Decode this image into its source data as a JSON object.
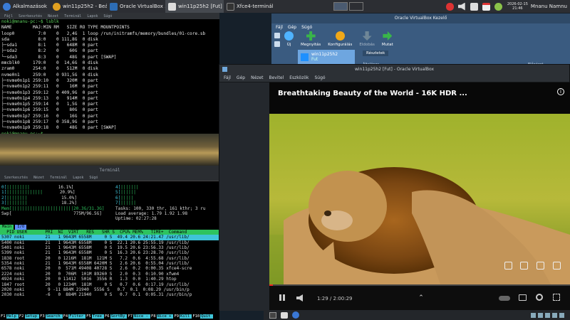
{
  "panel": {
    "apps_label": "Alkalmazások",
    "tasks": [
      "win11p25h2 - Beál...",
      "Oracle VirtualBox ...",
      "win11p25h2 [Fut] ...",
      "Xfce4-terminál"
    ],
    "date": "2026-02-15",
    "time": "21:46",
    "user": "Mnanu Namnu"
  },
  "term1": {
    "menu": [
      "Fájl",
      "Szerkesztés",
      "Nézet",
      "Terminál",
      "Lapok",
      "Súgó"
    ],
    "lines": [
      "noki@mnanu-pc:~$ lsblk",
      "NAME        MAJ:MIN RM   SIZE RO TYPE MOUNTPOINTS",
      "loop0         7:0    0   2,4G  1 loop /run/initramfs/memory/bundles/01-core.sb",
      "sda           8:0    0 111,8G  0 disk",
      "├─sda1        8:1    0   648M  0 part",
      "├─sda2        8:2    0    60G  0 part",
      "└─sda3        8:3    0    48G  0 part [SWAP]",
      "mmcblk0     179:0    0  14,6G  0 disk",
      "zram0       254:0    0   512M  0 disk",
      "nvme0n1     259:0    0 931,5G  0 disk",
      "├─nvme0n1p1 259:10   0   320M  0 part",
      "├─nvme0n1p2 259:11   0    16M  0 part",
      "├─nvme0n1p3 259:12   0 409,9G  0 part",
      "├─nvme0n1p4 259:13   0   914M  0 part",
      "├─nvme0n1p5 259:14   0   1,5G  0 part",
      "├─nvme0n1p6 259:15   0    80G  0 part",
      "├─nvme0n1p7 259:16   0    16G  0 part",
      "├─nvme0n1p8 259:17   0 358,9G  0 part",
      "└─nvme0n1p9 259:18   0    48G  0 part [SWAP]",
      "noki@mnanu-pc:~$ "
    ]
  },
  "term2": {
    "title": "Terminál",
    "menu": [
      "Szerkesztés",
      "Nézet",
      "Terminál",
      "Lapok",
      "Súgó"
    ],
    "cpu_left": [
      {
        "label": "0[",
        "bars": "|||||||||",
        "pct": "16.1%]"
      },
      {
        "label": "1[",
        "bars": "||||||||||||||",
        "pct": "20.9%]"
      },
      {
        "label": "2[",
        "bars": "||||||||",
        "pct": "15.0%]"
      },
      {
        "label": "3[",
        "bars": "||||||||",
        "pct": "18.2%]"
      }
    ],
    "cpu_right": [
      "4[",
      "5[",
      "6[",
      "7["
    ],
    "mem_line": "Mem[||||||||||||||||||||||||20.3G/31.3G]",
    "swp_line": "Swp[                        775M/96.5G]",
    "tasks": "Tasks: 100, 330 thr, 161 kthr; 3 ru",
    "load": "Load average: 1.79 1.92 1.98",
    "uptime": "Uptime: 02:27:28",
    "tabs": [
      "Main",
      "I/O"
    ],
    "header": "  PID USER       PRI  NI  VIRT   RES   SHR S  CPU% MEM%   TIME+  Command",
    "rows": [
      "5307 noki        21   1 9643M 6558M     0 S  49.4 20.6 24:21.47 /usr/lib/",
      "5400 noki        21   1 9643M 6558M     0 S  22.1 20.6 25:55.19 /usr/lib/",
      "5401 noki        21   1 9643M 6558M     0 S  19.5 20.6 23:56.33 /usr/lib/",
      "5399 noki        21   1 9643M 6558M     0 S  16.3 20.6 23:28.70 /usr/lib/",
      "1838 root        20   0 1216M  181M  121M S   7.2  0.6  4:55.68 /usr/lib/",
      "5354 noki        21   1 9643M 6558M 6420M S   2.6 20.6  0:55.04 /usr/lib/",
      "6578 noki        20   0  571M 49408 40728 S   2.6  0.2  0:00.35 xfce4-scre",
      "2224 noki        20   0  706M  101M 89260 S   2.0  0.3  0:10.90 xfwm4",
      "4924 noki        20   0 11412  5016  3556 R   1.3  0.0  1:40.29 htop",
      "1847 root        20   0 1234M  181M     0 S   0.7  0.6  0:17.19 /usr/lib/",
      "2020 noki         9 -11 884M 21940  5556 S   0.7  0.1  0:08.29 /usr/bin/p",
      "2030 noki        -6   0  884M 21940     0 S   0.7  0.1  0:05.31 /usr/bin/p"
    ],
    "fkeys": [
      {
        "k": "F1",
        "l": "Help"
      },
      {
        "k": "F2",
        "l": "Setup"
      },
      {
        "k": "F3",
        "l": "Search"
      },
      {
        "k": "F4",
        "l": "Filter"
      },
      {
        "k": "F5",
        "l": "Tree"
      },
      {
        "k": "F6",
        "l": "SortBy"
      },
      {
        "k": "F7",
        "l": "Nice -"
      },
      {
        "k": "F8",
        "l": "Nice +"
      },
      {
        "k": "F9",
        "l": "Kill"
      },
      {
        "k": "F10",
        "l": "Quit"
      }
    ]
  },
  "vbox_manager": {
    "title": "Oracle VirtualBox Kezelő",
    "menu": [
      "Fájl",
      "Gép",
      "Súgó"
    ],
    "toolbar": [
      "Új",
      "Megnyitás",
      "Konfigurálás",
      "Eldobás",
      "Mutat"
    ],
    "vm_name": "win11p25h2",
    "vm_state": "Fut",
    "tab_details": "Részletek",
    "general": "Általános",
    "preview": "Előnézet"
  },
  "vm_window": {
    "title": "win11p25h2 [Fut] - Oracle VirtualBox",
    "menu": [
      "Fájl",
      "Gép",
      "Nézet",
      "Bevitel",
      "Eszközök",
      "Súgó"
    ],
    "video_title": "Breathtaking Beauty of the World - 16K HDR ...",
    "time": "1:29 / 2:00:29"
  },
  "colors": {
    "htop_green": "#2ec35e",
    "htop_cyan": "#3fc4d8",
    "vbox_blue": "#3a5b80"
  }
}
